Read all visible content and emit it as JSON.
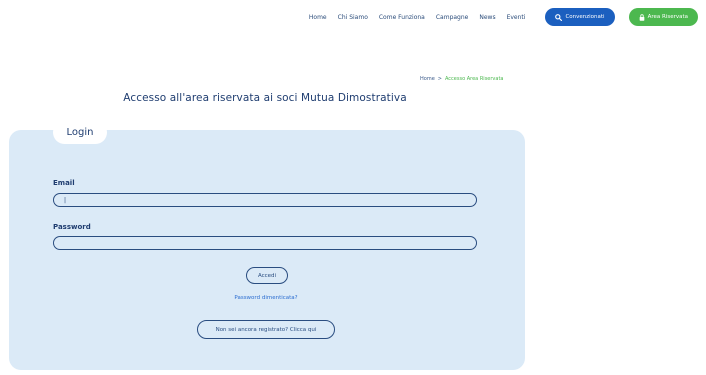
{
  "nav": {
    "links": [
      "Home",
      "Chi Siamo",
      "Come Funziona",
      "Campagne",
      "News",
      "Eventi"
    ],
    "convenzionati": {
      "label": "Convenzionati",
      "icon": "search-icon"
    },
    "area_riservata": {
      "label": "Area Riservata",
      "icon": "lock-icon"
    }
  },
  "breadcrumb": {
    "home": "Home",
    "separator": ">",
    "current": "Accesso Area Riservata"
  },
  "page_title": "Accesso all'area riservata ai soci Mutua Dimostrativa",
  "login": {
    "tab_label": "Login",
    "email_label": "Email",
    "email_value": "|",
    "password_label": "Password",
    "password_value": "",
    "submit_label": "Accedi",
    "forgot_label": "Password dimenticata?",
    "register_label": "Non sei ancora registrato? Clicca qui"
  },
  "colors": {
    "primary_blue": "#1b5fbf",
    "green": "#4cb84f",
    "panel_bg": "#dbeaf7",
    "text_navy": "#1f3d70"
  }
}
